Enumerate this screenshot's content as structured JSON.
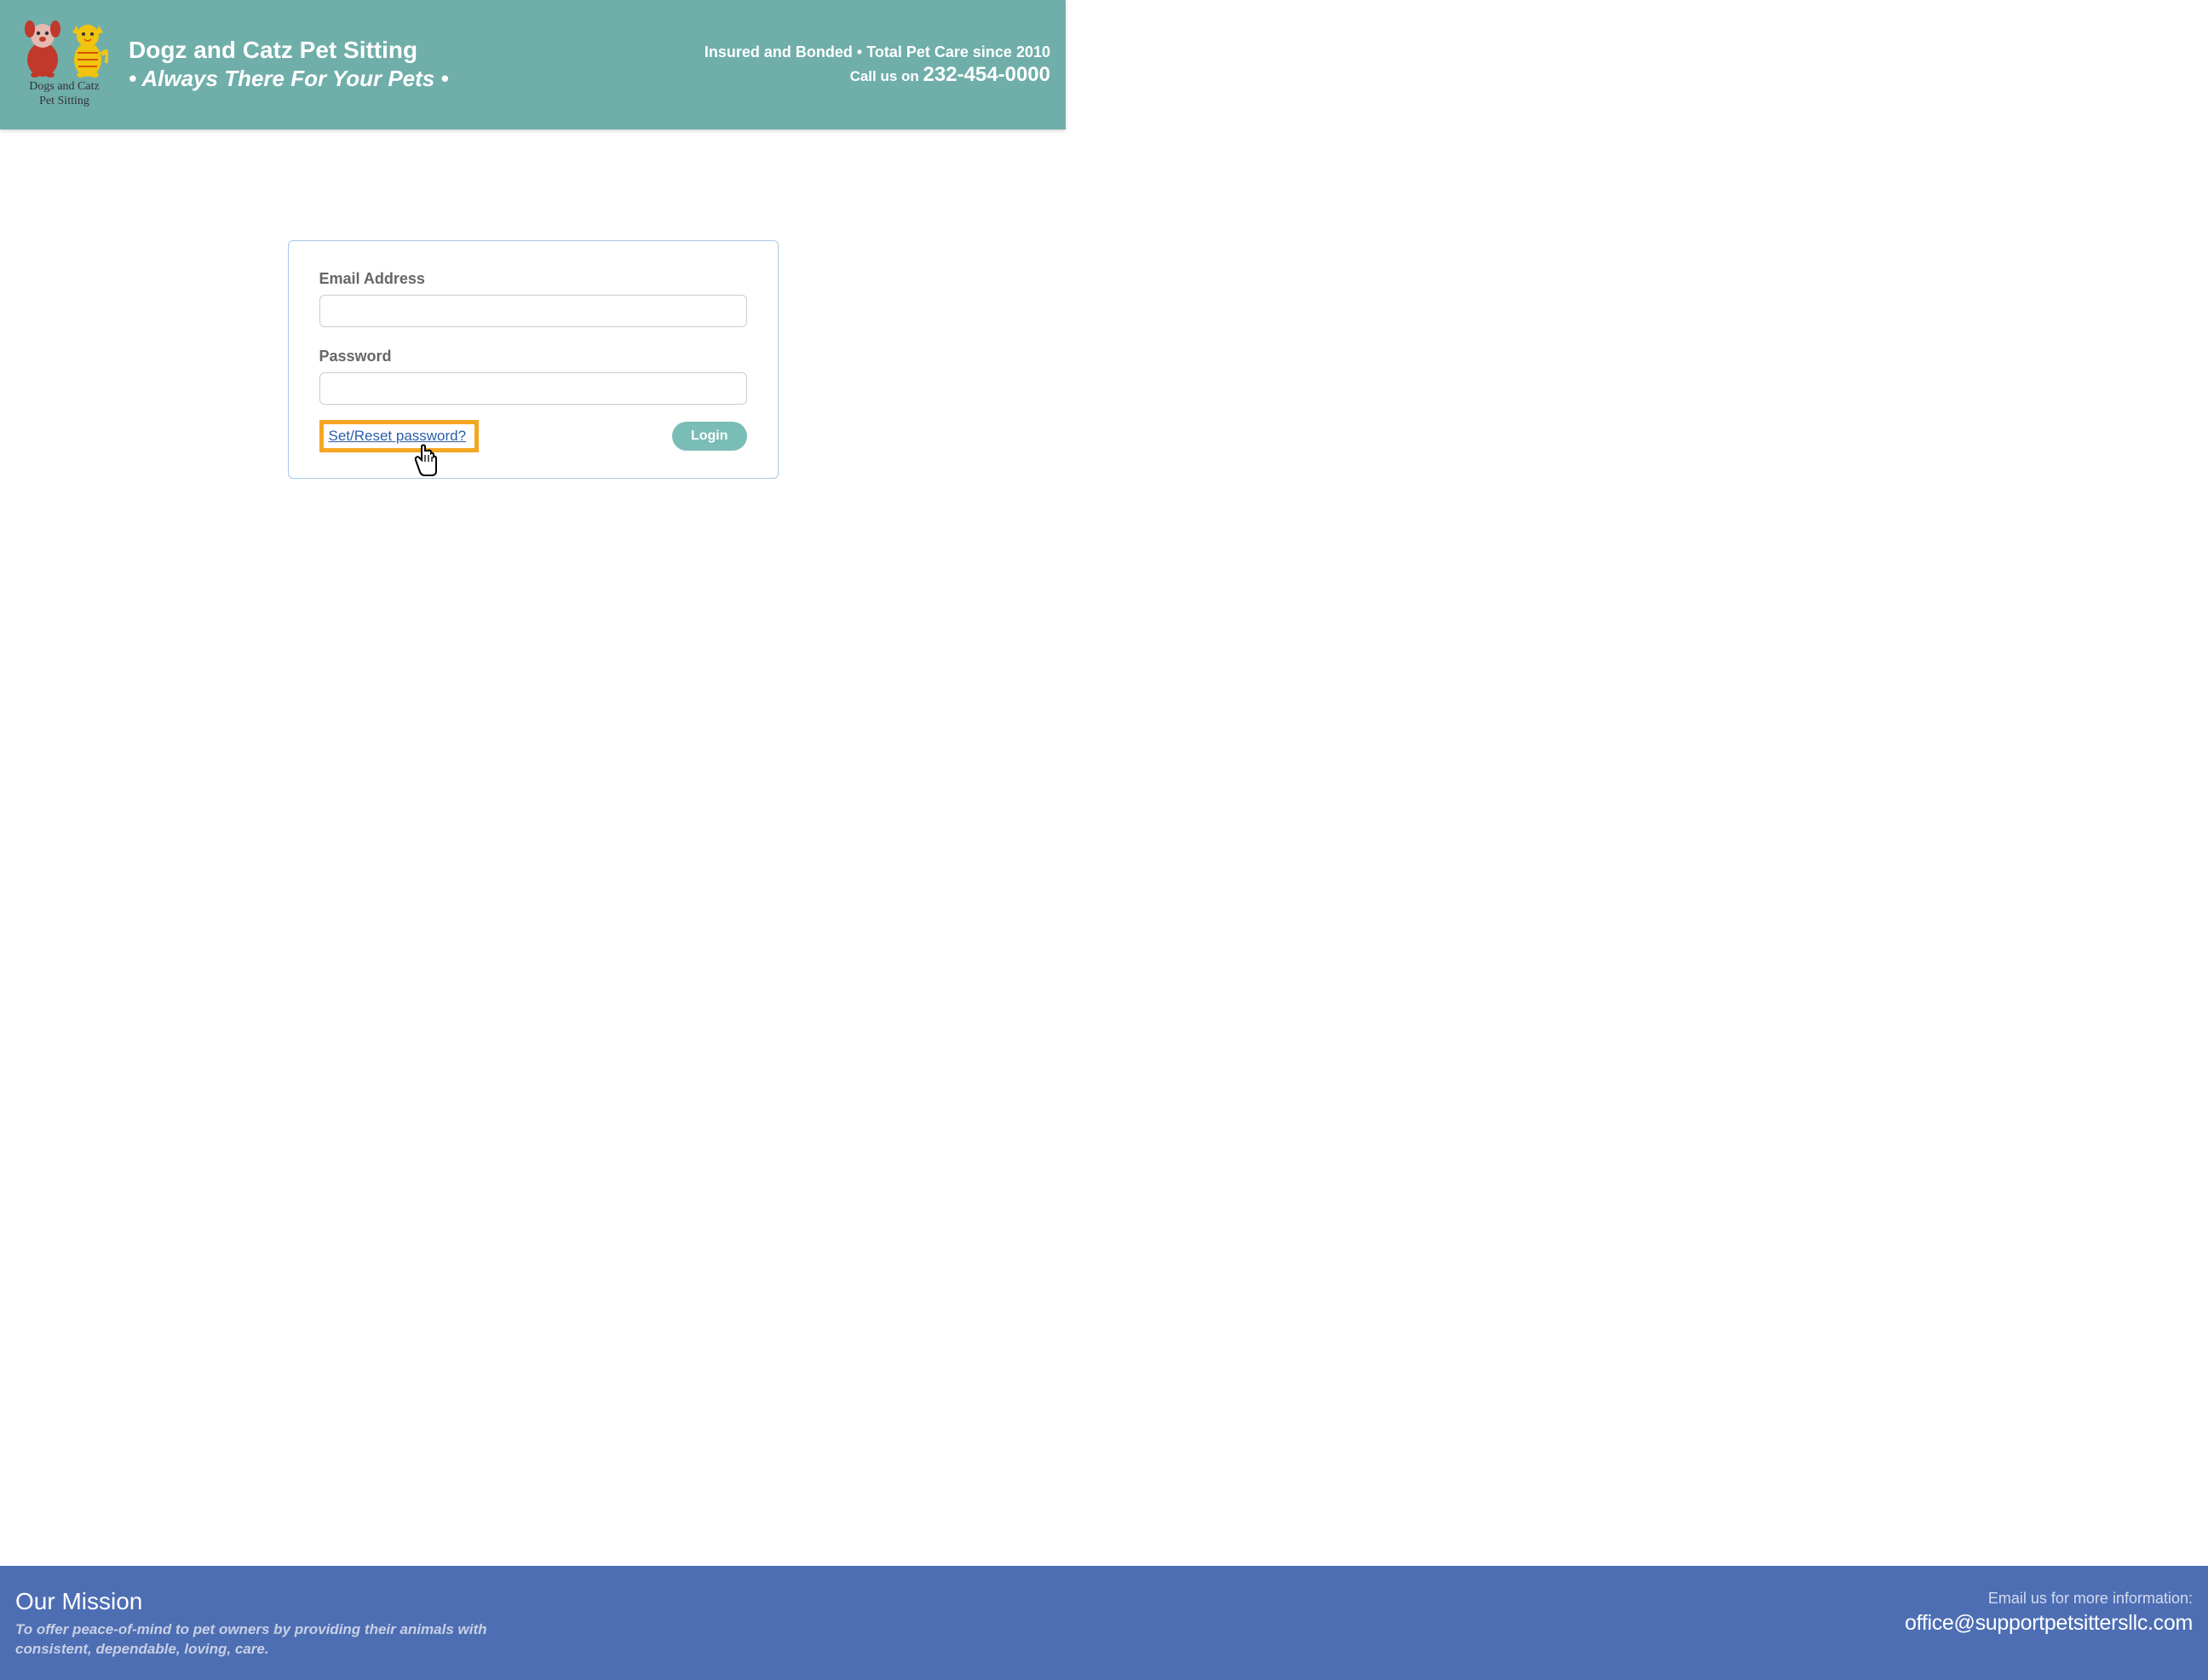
{
  "header": {
    "logo_line1": "Dogs and Catz",
    "logo_line2": "Pet Sitting",
    "title": "Dogz and Catz Pet Sitting",
    "tagline": "• Always There For Your Pets •",
    "insured_text": "Insured and Bonded • Total Pet Care since 2010",
    "call_label": "Call us on ",
    "phone": "232-454-0000"
  },
  "login": {
    "email_label": "Email Address",
    "email_value": "",
    "password_label": "Password",
    "password_value": "",
    "reset_link": "Set/Reset password?",
    "login_button": "Login"
  },
  "footer": {
    "heading": "Our Mission",
    "mission": "To offer peace-of-mind to pet owners by providing their animals with consistent, dependable, loving, care.",
    "email_label": "Email us for more information:",
    "email": "office@supportpetsittersllc.com"
  },
  "colors": {
    "header_bg": "#6faea9",
    "footer_bg": "#4d6eb3",
    "highlight_border": "#f5a623",
    "button_bg": "#7abdb6",
    "link_color": "#2b5eaa"
  }
}
